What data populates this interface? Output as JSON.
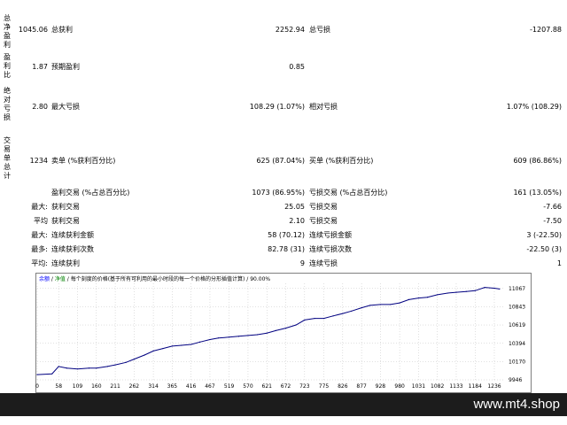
{
  "side_labels": [
    "总净盈利",
    "盈利比",
    "绝对亏损",
    "交易单总计"
  ],
  "stats": {
    "row1": {
      "left_val": "1045.06",
      "label1": "总获利",
      "val1": "2252.94",
      "label2": "总亏损",
      "val2": "-1207.88"
    },
    "row2": {
      "left_val": "1.87",
      "label1": "预期盈利",
      "val1": "0.85"
    },
    "row3": {
      "left_val": "2.80",
      "label1": "最大亏损",
      "val1": "108.29 (1.07%)",
      "label2": "相对亏损",
      "val2": "1.07% (108.29)"
    },
    "row4": {
      "left_val": "1234",
      "label1": "卖单 (%获利百分比)",
      "val1": "625 (87.04%)",
      "label2": "买单 (%获利百分比)",
      "val2": "609 (86.86%)"
    },
    "row5": {
      "label1": "盈利交易 (%占总百分比)",
      "val1": "1073 (86.95%)",
      "label2": "亏损交易 (%占总百分比)",
      "val2": "161 (13.05%)"
    },
    "row6": {
      "prefix": "最大:",
      "label1": "获利交易",
      "val1": "25.05",
      "label2": "亏损交易",
      "val2": "-7.66"
    },
    "row7": {
      "prefix": "平均",
      "label1": "获利交易",
      "val1": "2.10",
      "label2": "亏损交易",
      "val2": "-7.50"
    },
    "row8": {
      "prefix": "最大:",
      "label1": "连续获利金额",
      "val1": "58 (70.12)",
      "label2": "连续亏损金额",
      "val2": "3 (-22.50)"
    },
    "row9": {
      "prefix": "最多:",
      "label1": "连续获利次数",
      "val1": "82.78 (31)",
      "label2": "连续亏损次数",
      "val2": "-22.50 (3)"
    },
    "row10": {
      "prefix": "平均:",
      "label1": "连续获利",
      "val1": "9",
      "label2": "连续亏损",
      "val2": "1"
    }
  },
  "chart_header": {
    "part1": "余额",
    "sep1": " / ",
    "part2": "净值",
    "part3": " / 每个刻度的价格(基于所有可利用的最小时段的每一个价格的分形插值计算) / 90.00%"
  },
  "colors": {
    "balance": "#000080",
    "header_blue": "#0000ff",
    "header_green": "#008000",
    "grid": "#c0c0c0"
  },
  "chart_data": {
    "type": "line",
    "x_ticks": [
      0,
      58,
      109,
      160,
      211,
      262,
      314,
      365,
      416,
      467,
      519,
      570,
      621,
      672,
      723,
      775,
      826,
      877,
      928,
      980,
      1031,
      1082,
      1133,
      1184,
      1236
    ],
    "y_ticks": [
      9946,
      10170,
      10394,
      10619,
      10843,
      11067
    ],
    "xlim": [
      0,
      1260
    ],
    "ylim": [
      9946,
      11130
    ],
    "series": [
      {
        "x": [
          0,
          40,
          58,
          80,
          109,
          140,
          160,
          190,
          211,
          240,
          262,
          290,
          314,
          340,
          365,
          390,
          416,
          440,
          467,
          490,
          519,
          545,
          570,
          595,
          621,
          645,
          672,
          700,
          723,
          750,
          775,
          800,
          826,
          850,
          877,
          900,
          928,
          955,
          980,
          1005,
          1031,
          1055,
          1082,
          1110,
          1133,
          1160,
          1184,
          1210,
          1236,
          1250
        ],
        "y": [
          10010,
          10020,
          10110,
          10090,
          10080,
          10090,
          10090,
          10110,
          10130,
          10160,
          10200,
          10250,
          10300,
          10330,
          10360,
          10370,
          10380,
          10410,
          10440,
          10460,
          10470,
          10480,
          10490,
          10500,
          10520,
          10550,
          10580,
          10620,
          10680,
          10700,
          10700,
          10730,
          10760,
          10790,
          10830,
          10860,
          10870,
          10870,
          10890,
          10930,
          10950,
          10960,
          10990,
          11010,
          11020,
          11030,
          11040,
          11080,
          11070,
          11060
        ]
      }
    ]
  },
  "watermark": "www.mt4.shop"
}
